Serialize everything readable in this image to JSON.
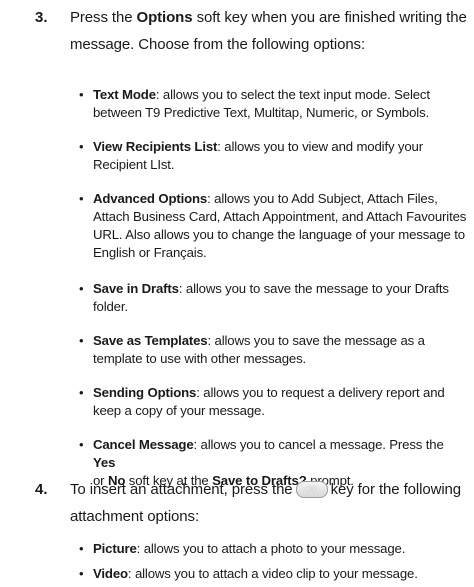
{
  "step3": {
    "number": "3.",
    "intro_pre": "Press the ",
    "intro_bold": "Options",
    "intro_post": " soft key when you are finished writing the message. Choose from the following options:"
  },
  "options": [
    {
      "title": "Text Mode",
      "desc": ": allows you to select the text input mode. Select between T9 Predictive Text, Multitap, Numeric, or Symbols."
    },
    {
      "title": "View Recipients List",
      "desc": ": allows you to view and modify your Recipient LIst."
    },
    {
      "title": "Advanced Options",
      "desc": ": allows you to Add Subject, Attach Files, Attach Business Card, Attach Appointment, and Attach Favourites URL. Also allows you to change the language of your message to English or Français."
    },
    {
      "title": "Save in Drafts",
      "desc": ": allows you to save the message to your Drafts folder."
    },
    {
      "title": "Save as Templates",
      "desc": ": allows you to save the message as a template to use with other messages."
    },
    {
      "title": "Sending Options",
      "desc": ": allows you to request a delivery report and keep a copy of your message."
    }
  ],
  "cancel_option": {
    "title": "Cancel Message",
    "desc_a": ": allows you to cancel a message. Press the ",
    "yes": "Yes",
    "desc_b": " or ",
    "no": "No",
    "desc_c": " soft key at the ",
    "prompt": "Save to Drafts?",
    "desc_d": " prompt."
  },
  "step4": {
    "number": "4.",
    "text_pre": "To insert an attachment, press the",
    "key_label": "OK",
    "text_post": "key for the following attachment options:"
  },
  "attachments": [
    {
      "title": "Picture",
      "desc": ": allows you to attach a photo to your message."
    },
    {
      "title": "Video",
      "desc": ": allows you to attach a video clip to your message."
    }
  ]
}
